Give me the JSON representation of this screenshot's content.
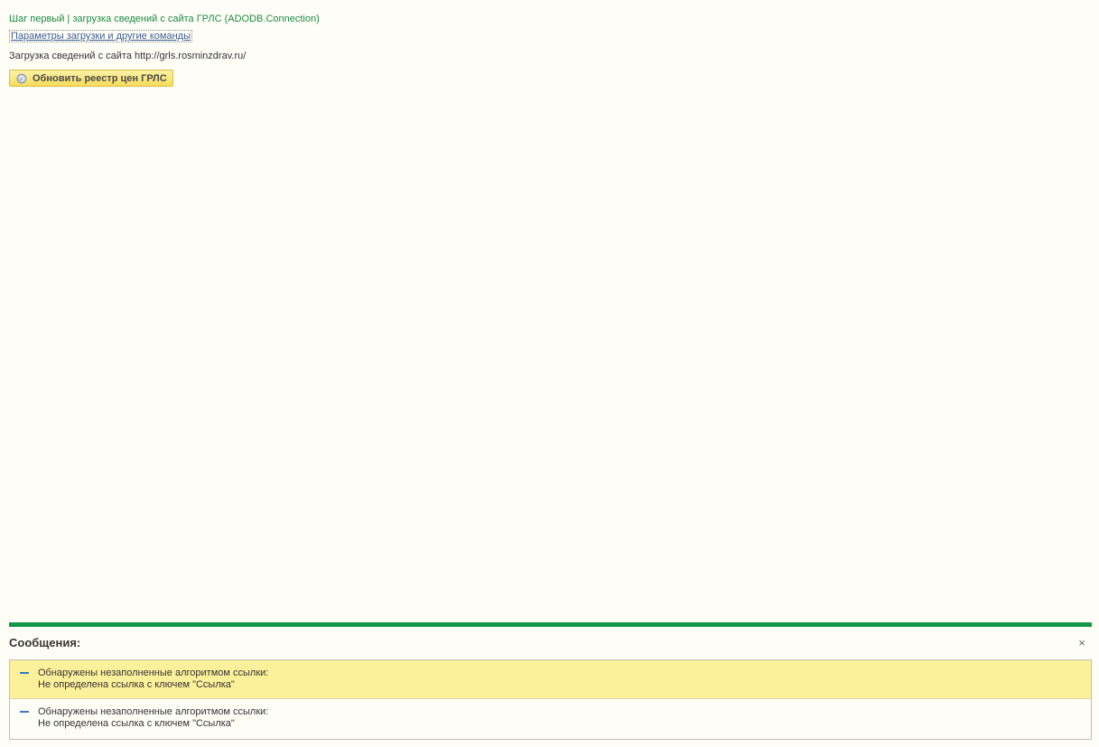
{
  "header": {
    "step_title": "Шаг первый | загрузка сведений с сайта ГРЛС (ADODB.Connection)",
    "params_link": "Параметры загрузки и другие команды",
    "load_info": "Загрузка сведений с сайта http://grls.rosminzdrav.ru/",
    "update_button": {
      "label": "Обновить реестр цен ГРЛС",
      "icon": "refresh-icon"
    }
  },
  "messages": {
    "title": "Сообщения:",
    "close_label": "×",
    "items": [
      {
        "line1": "Обнаружены незаполненные алгоритмом ссылки:",
        "line2": "Не определена ссылка с ключем \"Ссылка\"",
        "selected": true
      },
      {
        "line1": "Обнаружены незаполненные алгоритмом ссылки:",
        "line2": "Не определена ссылка с ключем \"Ссылка\"",
        "selected": false
      }
    ]
  },
  "colors": {
    "background": "#fffef6",
    "accent_green": "#139648",
    "title_green": "#1a8a4a",
    "link_blue": "#3e5d97",
    "button_yellow": "#f5dc5a",
    "selected_row": "#fdf09a",
    "dash_blue": "#3a78c2"
  }
}
